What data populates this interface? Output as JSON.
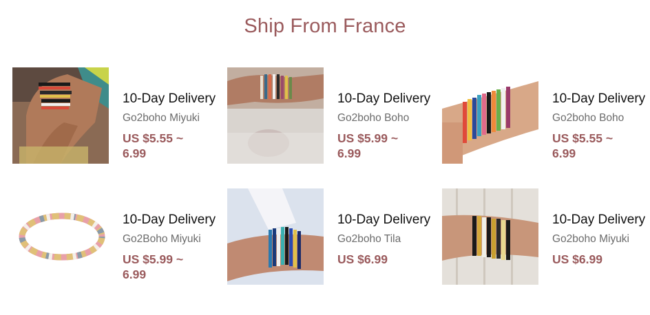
{
  "section": {
    "title": "Ship From France"
  },
  "products": [
    {
      "image_icon": "bracelet-photo",
      "delivery": "10-Day Delivery",
      "shop": "Go2boho Miyuki",
      "price": "US $5.55 ~ 6.99"
    },
    {
      "image_icon": "bracelet-photo",
      "delivery": "10-Day Delivery",
      "shop": "Go2boho Boho",
      "price": "US $5.99 ~ 6.99"
    },
    {
      "image_icon": "bracelet-photo",
      "delivery": "10-Day Delivery",
      "shop": "Go2boho Boho",
      "price": "US $5.55 ~ 6.99"
    },
    {
      "image_icon": "bracelet-photo",
      "delivery": "10-Day Delivery",
      "shop": "Go2Boho Miyuki",
      "price": "US $5.99 ~ 6.99"
    },
    {
      "image_icon": "bracelet-photo",
      "delivery": "10-Day Delivery",
      "shop": "Go2boho Tila",
      "price": "US $6.99"
    },
    {
      "image_icon": "bracelet-photo",
      "delivery": "10-Day Delivery",
      "shop": "Go2boho Miyuki",
      "price": "US $6.99"
    }
  ],
  "colors": {
    "accent": "#9a5a5c",
    "text": "#111111",
    "muted": "#6b6b6b"
  }
}
